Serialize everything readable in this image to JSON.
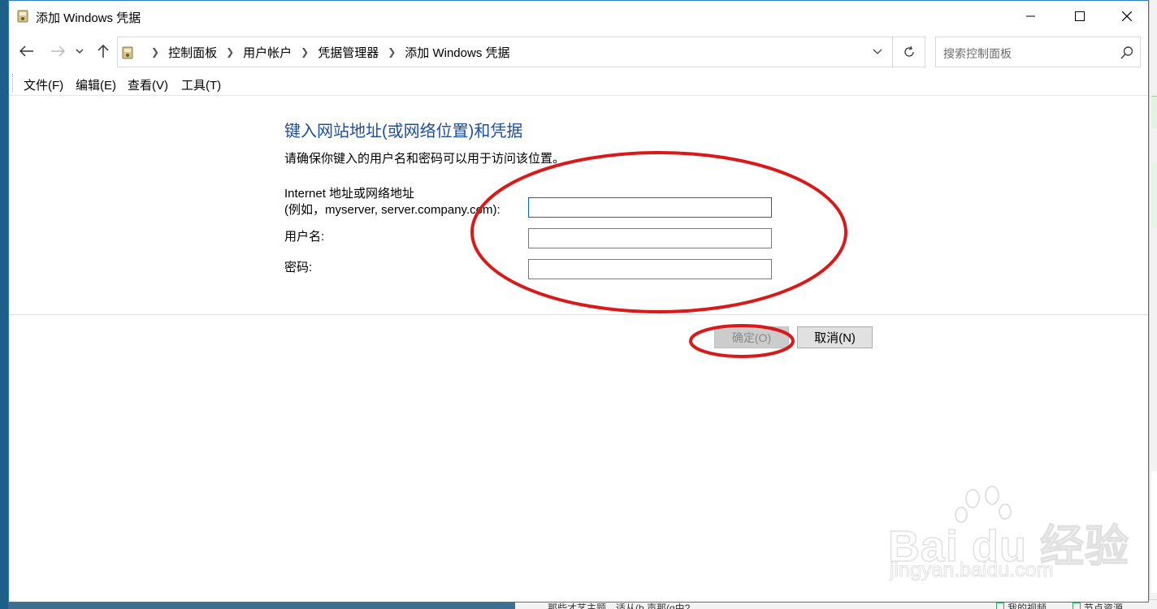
{
  "window": {
    "title": "添加 Windows 凭据"
  },
  "address": {
    "breadcrumbs": [
      "控制面板",
      "用户帐户",
      "凭据管理器",
      "添加 Windows 凭据"
    ]
  },
  "search": {
    "placeholder": "搜索控制面板"
  },
  "menu": {
    "file": "文件(F)",
    "edit": "编辑(E)",
    "view": "查看(V)",
    "tools": "工具(T)"
  },
  "form": {
    "heading": "键入网站地址(或网络位置)和凭据",
    "instruction": "请确保你键入的用户名和密码可以用于访问该位置。",
    "url_label_line1": "Internet 地址或网络地址",
    "url_label_line2": "(例如，myserver, server.company.com):",
    "username_label": "用户名:",
    "password_label": "密码:",
    "url_value": "",
    "username_value": "",
    "password_value": ""
  },
  "buttons": {
    "ok": "确定(O)",
    "cancel": "取消(N)"
  },
  "background": {
    "taskbar_text": "那些才艺主题，适从(b 声那(ɑ由?",
    "check1": "我的视频",
    "check2": "节点资源"
  },
  "watermark": {
    "main": "Bai du 经验",
    "sub": "jingyan.baidu.com"
  },
  "colors": {
    "heading": "#1e4e9e",
    "annotation_red": "#d91a1a",
    "window_border": "#2b7bc0"
  }
}
